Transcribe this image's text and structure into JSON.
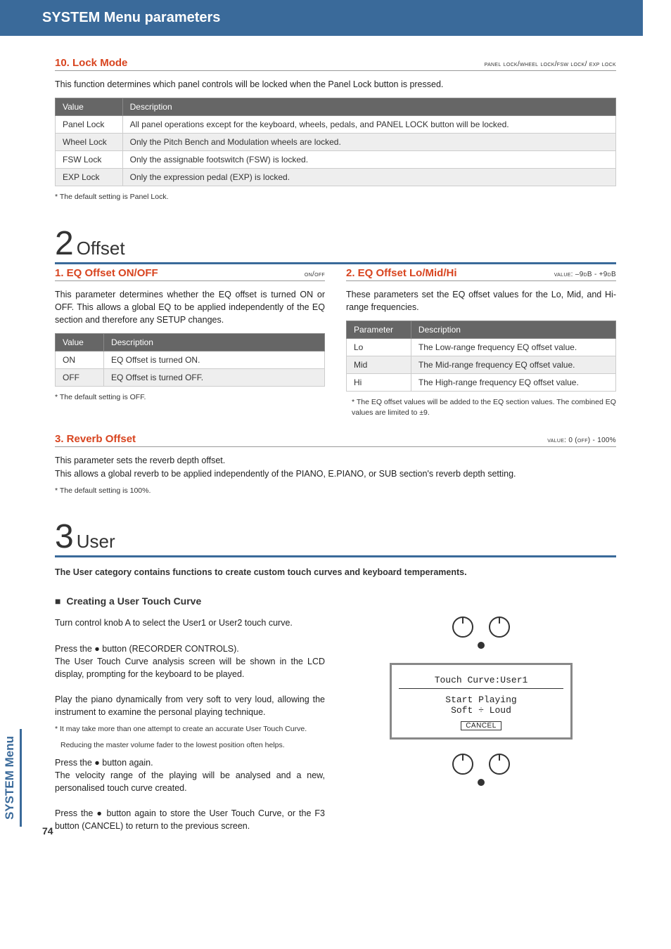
{
  "header": {
    "title": "SYSTEM Menu parameters"
  },
  "side_tab": "SYSTEM Menu",
  "page_number": "74",
  "p10": {
    "title": "10. Lock Mode",
    "range": "panel lock/wheel lock/fsw lock/ exp lock",
    "intro": "This function determines which panel controls will be locked when the Panel Lock button is pressed.",
    "th1": "Value",
    "th2": "Description",
    "rows": [
      {
        "v": "Panel Lock",
        "d": "All panel operations except for the keyboard, wheels, pedals, and PANEL LOCK button will be locked."
      },
      {
        "v": "Wheel Lock",
        "d": "Only the Pitch Bench and Modulation wheels are locked."
      },
      {
        "v": "FSW Lock",
        "d": "Only the assignable footswitch (FSW) is locked."
      },
      {
        "v": "EXP Lock",
        "d": "Only the expression pedal (EXP) is locked."
      }
    ],
    "footnote": "* The default setting is Panel Lock."
  },
  "sec2": {
    "num": "2",
    "title": "Offset",
    "p1": {
      "title": "1. EQ Offset ON/OFF",
      "range": "on/off",
      "body": "This parameter determines whether the EQ offset is turned ON or OFF.  This allows a global EQ to be applied independently of the EQ section and therefore any SETUP changes.",
      "th1": "Value",
      "th2": "Description",
      "rows": [
        {
          "v": "ON",
          "d": "EQ Offset is turned ON."
        },
        {
          "v": "OFF",
          "d": "EQ Offset is turned OFF."
        }
      ],
      "footnote": "* The default setting is OFF."
    },
    "p2": {
      "title": "2. EQ Offset Lo/Mid/Hi",
      "range": "value: –9dB - +9dB",
      "body": "These parameters set the EQ offset values for the Lo, Mid, and Hi-range frequencies.",
      "th1": "Parameter",
      "th2": "Description",
      "rows": [
        {
          "v": "Lo",
          "d": "The Low-range frequency EQ offset value."
        },
        {
          "v": "Mid",
          "d": "The Mid-range frequency EQ offset value."
        },
        {
          "v": "Hi",
          "d": "The High-range frequency EQ offset value."
        }
      ],
      "footnote": "* The EQ offset values will be added to the EQ section values.  The combined EQ values are limited to ±9."
    },
    "p3": {
      "title": "3. Reverb Offset",
      "range": "value: 0 (off) - 100%",
      "body1": "This parameter sets the reverb depth offset.",
      "body2": "This allows a global reverb to be applied independently of the PIANO, E.PIANO, or SUB section's reverb depth setting.",
      "footnote": "* The default setting is 100%."
    }
  },
  "sec3": {
    "num": "3",
    "title": "User",
    "intro": "The User category contains functions to create custom touch curves and keyboard temperaments.",
    "subhead": "Creating a User Touch Curve",
    "steps": {
      "a": "Turn control knob A to select the User1 or User2 touch curve.",
      "b": "Press the ● button (RECORDER CONTROLS).",
      "c": "The User Touch Curve analysis screen will be shown in the LCD display, prompting for the keyboard to be played.",
      "d": "Play the piano dynamically from very soft to very loud, allowing the instrument to examine the personal playing technique.",
      "note1": "* It may take more than one attempt to create an accurate User Touch Curve.",
      "note2": "Reducing the master volume fader to the lowest position often helps.",
      "e": "Press the ● button again.",
      "f": "The velocity range of the playing will be analysed and a new, personalised touch curve created.",
      "g": "Press the ● button again to store the User Touch Curve, or the F3 button (CANCEL) to return to the previous screen."
    },
    "lcd": {
      "line1": "Touch Curve:User1",
      "line2": "Start Playing",
      "line3": "Soft ÷ Loud",
      "cancel": "CANCEL"
    }
  }
}
